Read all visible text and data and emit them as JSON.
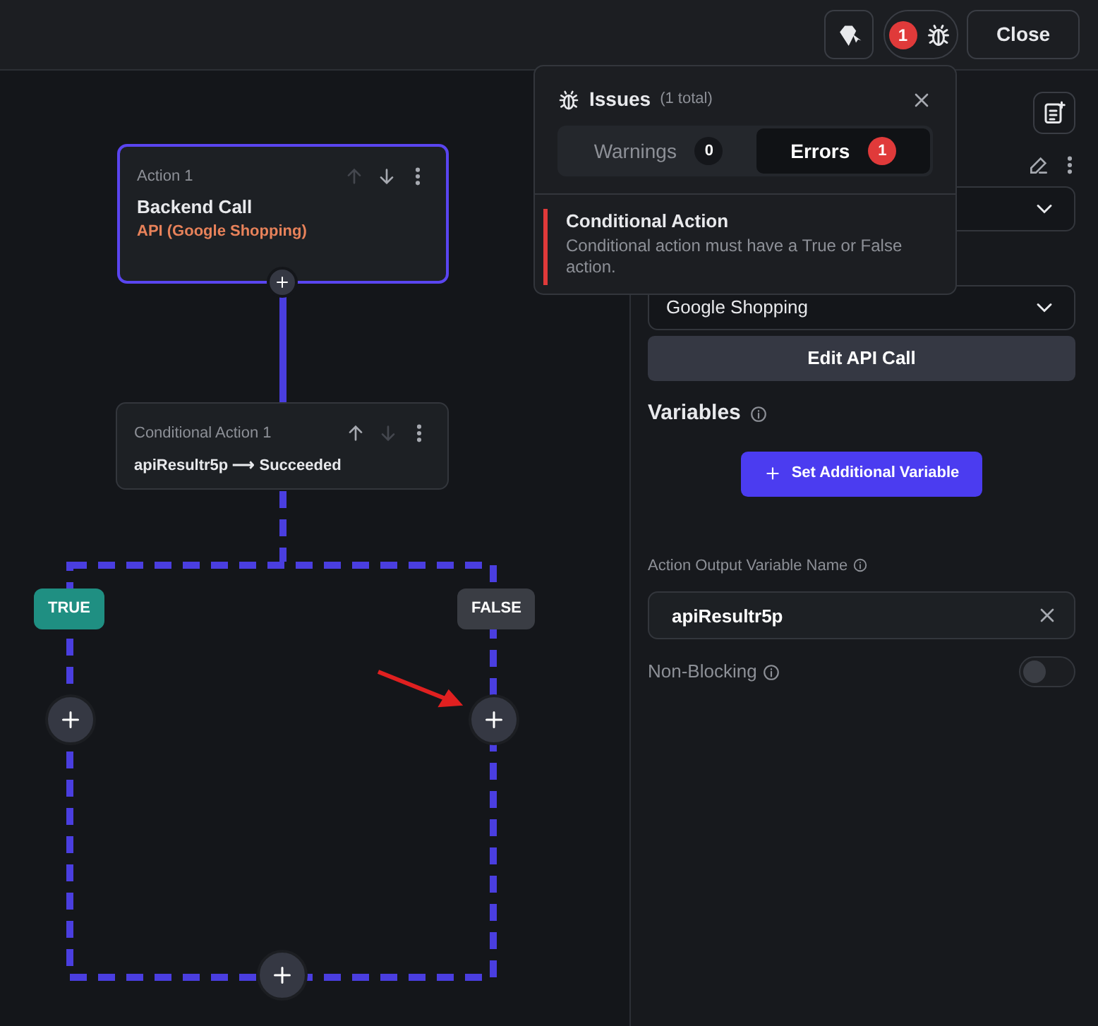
{
  "top_bar": {
    "issue_count": "1",
    "close_label": "Close"
  },
  "issues_popover": {
    "title": "Issues",
    "total": "(1 total)",
    "tabs": [
      {
        "label": "Warnings",
        "count": "0",
        "selected": false
      },
      {
        "label": "Errors",
        "count": "1",
        "selected": true
      }
    ],
    "items": [
      {
        "title": "Conditional Action",
        "message": "Conditional action must have a True or False action."
      }
    ]
  },
  "canvas": {
    "nodes": [
      {
        "kind": "action",
        "label": "Action 1",
        "title": "Backend Call",
        "subtitle": "API (Google Shopping)",
        "selected": true,
        "up_disabled": true,
        "down_disabled": false
      },
      {
        "kind": "condition",
        "label": "Conditional Action 1",
        "condition": "apiResultr5p ⟶ Succeeded",
        "selected": false,
        "up_disabled": false,
        "down_disabled": true
      }
    ],
    "branches": [
      {
        "label": "TRUE",
        "color": "#1f8f82"
      },
      {
        "label": "FALSE",
        "color": "#3a3d44"
      }
    ]
  },
  "panel": {
    "api_select": "Google Shopping",
    "edit_button": "Edit API Call",
    "variables_heading": "Variables",
    "add_variable_button": "Set Additional Variable",
    "output_label": "Action Output Variable Name",
    "output_value": "apiResultr5p",
    "non_blocking": {
      "label": "Non-Blocking",
      "on": false
    }
  }
}
